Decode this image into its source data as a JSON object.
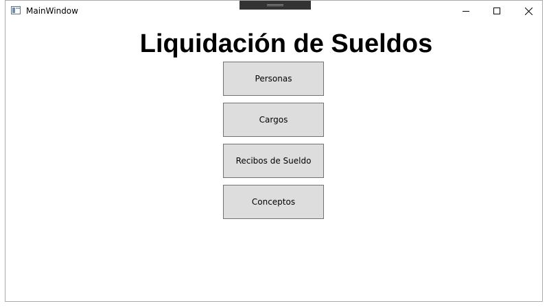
{
  "window": {
    "title": "MainWindow",
    "minimize_icon": "minimize-icon",
    "maximize_icon": "maximize-icon",
    "close_icon": "close-icon"
  },
  "main": {
    "heading": "Liquidación de Sueldos",
    "buttons": [
      {
        "label": "Personas"
      },
      {
        "label": "Cargos"
      },
      {
        "label": "Recibos de Sueldo"
      },
      {
        "label": "Conceptos"
      }
    ]
  },
  "colors": {
    "button_background": "#dddddd",
    "button_border": "#707070",
    "window_background": "#ffffff"
  }
}
